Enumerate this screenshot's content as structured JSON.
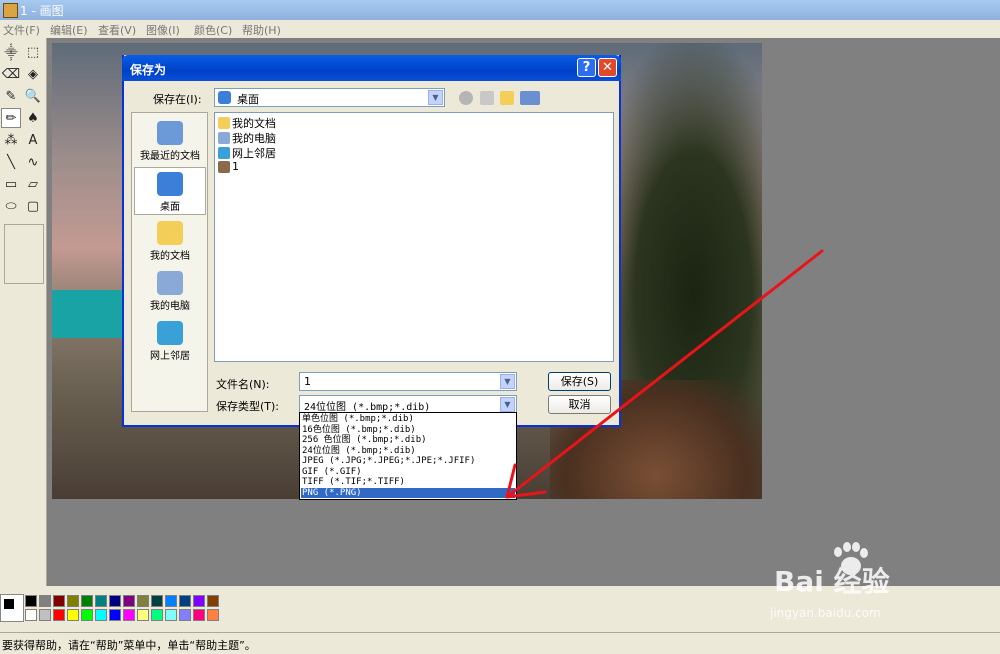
{
  "app": {
    "title": "1 - 画图"
  },
  "menu": [
    "文件(F)",
    "编辑(E)",
    "查看(V)",
    "图像(I)",
    "颜色(C)",
    "帮助(H)"
  ],
  "tools": [
    "free-select-icon",
    "rect-select-icon",
    "eraser-icon",
    "fill-icon",
    "color-picker-icon",
    "magnifier-icon",
    "pencil-icon",
    "brush-icon",
    "airbrush-icon",
    "text-icon",
    "line-icon",
    "curve-icon",
    "rectangle-icon",
    "polygon-icon",
    "ellipse-icon",
    "rounded-rect-icon"
  ],
  "tool_glyphs": [
    "⸎",
    "⬚",
    "⌫",
    "◈",
    "✎",
    "🔍",
    "✏",
    "♠",
    "⁂",
    "A",
    "╲",
    "∿",
    "▭",
    "▱",
    "⬭",
    "▢"
  ],
  "dialog": {
    "title": "保存为",
    "help_label": "?",
    "close_label": "✕",
    "save_in_label": "保存在(I):",
    "save_in_value": "桌面",
    "places": [
      {
        "label": "我最近的文档",
        "icon": "recent-documents-icon",
        "color": "#6c9ad8"
      },
      {
        "label": "桌面",
        "icon": "desktop-icon",
        "color": "#3b7fd8"
      },
      {
        "label": "我的文档",
        "icon": "my-documents-icon",
        "color": "#f3cf5a"
      },
      {
        "label": "我的电脑",
        "icon": "my-computer-icon",
        "color": "#8aa9d6"
      },
      {
        "label": "网上邻居",
        "icon": "network-places-icon",
        "color": "#3aa0d8"
      }
    ],
    "files": [
      {
        "name": "我的文档",
        "icon": "folder-icon",
        "color": "#f3cf5a"
      },
      {
        "name": "我的电脑",
        "icon": "computer-icon",
        "color": "#8aa9d6"
      },
      {
        "name": "网上邻居",
        "icon": "network-icon",
        "color": "#3aa0d8"
      },
      {
        "name": "1",
        "icon": "image-file-icon",
        "color": "#8a6a4a"
      }
    ],
    "filename_label": "文件名(N):",
    "filename_value": "1",
    "filetype_label": "保存类型(T):",
    "filetype_value": "24位位图 (*.bmp;*.dib)",
    "save_button": "保存(S)",
    "cancel_button": "取消",
    "type_options": [
      "单色位图 (*.bmp;*.dib)",
      "16色位图 (*.bmp;*.dib)",
      "256 色位图 (*.bmp;*.dib)",
      "24位位图 (*.bmp;*.dib)",
      "JPEG (*.JPG;*.JPEG;*.JPE;*.JFIF)",
      "GIF (*.GIF)",
      "TIFF (*.TIF;*.TIFF)",
      "PNG (*.PNG)"
    ],
    "selected_type_index": 7
  },
  "palette": {
    "row1": [
      "#000000",
      "#808080",
      "#800000",
      "#808000",
      "#008000",
      "#008080",
      "#000080",
      "#800080",
      "#808040",
      "#004040",
      "#0080ff",
      "#004080",
      "#8000ff",
      "#804000"
    ],
    "row2": [
      "#ffffff",
      "#c0c0c0",
      "#ff0000",
      "#ffff00",
      "#00ff00",
      "#00ffff",
      "#0000ff",
      "#ff00ff",
      "#ffff80",
      "#00ff80",
      "#80ffff",
      "#8080ff",
      "#ff0080",
      "#ff8040"
    ]
  },
  "status": "要获得帮助，请在“帮助”菜单中，单击“帮助主题”。",
  "watermark": {
    "logo": "Bai 经验",
    "url": "jingyan.baidu.com"
  },
  "annotation_color": "#e8141a"
}
